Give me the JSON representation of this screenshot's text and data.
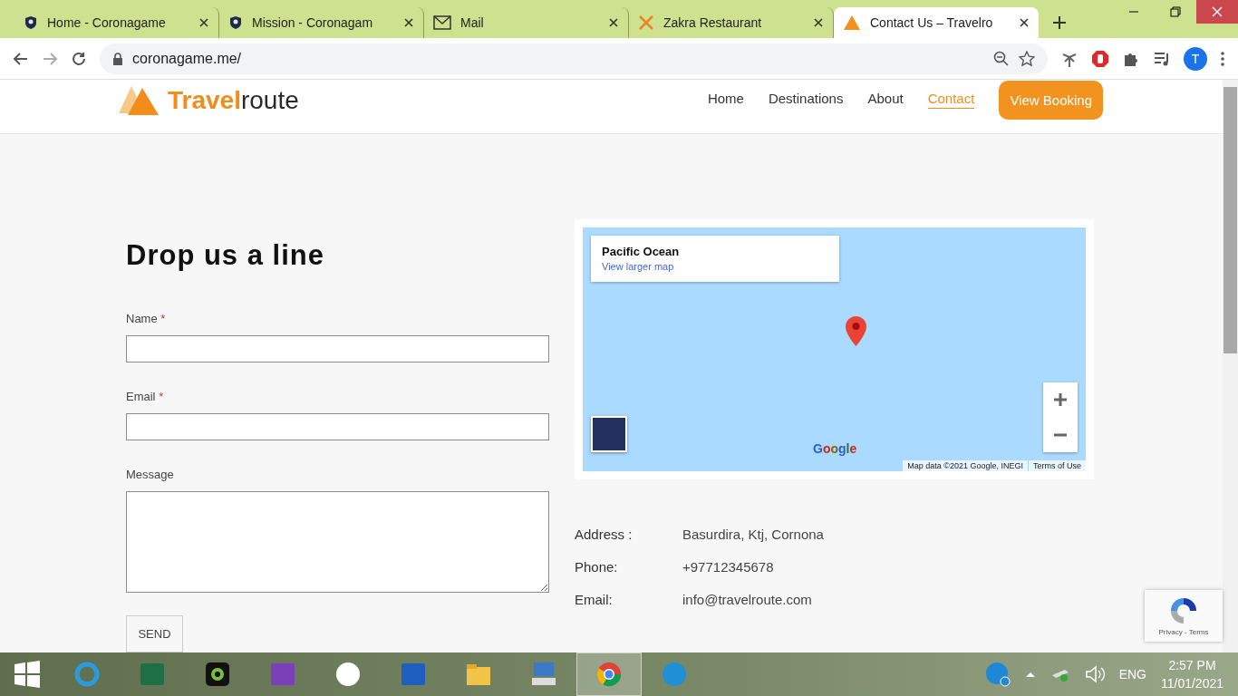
{
  "browser": {
    "tabs": [
      {
        "title": "Home - Coronagame",
        "selected": false
      },
      {
        "title": "Mission - Coronagam",
        "selected": false
      },
      {
        "title": "Mail",
        "selected": false
      },
      {
        "title": "Zakra Restaurant",
        "selected": false
      },
      {
        "title": "Contact Us – Travelro",
        "selected": true
      }
    ],
    "url": "coronagame.me/",
    "profile_initial": "T"
  },
  "site": {
    "logo": [
      "Travel",
      "route"
    ],
    "nav": [
      {
        "label": "Home",
        "selected": false
      },
      {
        "label": "Destinations",
        "selected": false
      },
      {
        "label": "About",
        "selected": false
      },
      {
        "label": "Contact",
        "selected": true
      }
    ],
    "booking_button": "View Booking"
  },
  "form": {
    "heading": "Drop us a line",
    "fields": [
      {
        "label": "Name",
        "required_mark": "*",
        "kind": "input"
      },
      {
        "label": "Email",
        "required_mark": "*",
        "kind": "input"
      },
      {
        "label": "Message",
        "kind": "textarea"
      }
    ],
    "submit": "SEND"
  },
  "map": {
    "place": "Pacific Ocean",
    "link": "View larger map",
    "brand": "Google",
    "attribution": "Map data ©2021 Google, INEGI",
    "terms": "Terms of Use"
  },
  "contact": [
    {
      "label": "Address :",
      "value": "Basurdira, Ktj, Cornona"
    },
    {
      "label": "Phone:",
      "value": "+97712345678"
    },
    {
      "label": "Email:",
      "value": "info@travelroute.com"
    }
  ],
  "recaptcha": "Privacy - Terms",
  "taskbar": {
    "apps": [
      {
        "selected": false
      },
      {
        "selected": false
      },
      {
        "selected": false
      },
      {
        "selected": false
      },
      {
        "selected": false
      },
      {
        "selected": false
      },
      {
        "selected": false
      },
      {
        "selected": false
      },
      {
        "selected": true
      },
      {
        "selected": false
      }
    ],
    "language": "ENG",
    "time": "2:57 PM",
    "date": "11/01/2021"
  }
}
